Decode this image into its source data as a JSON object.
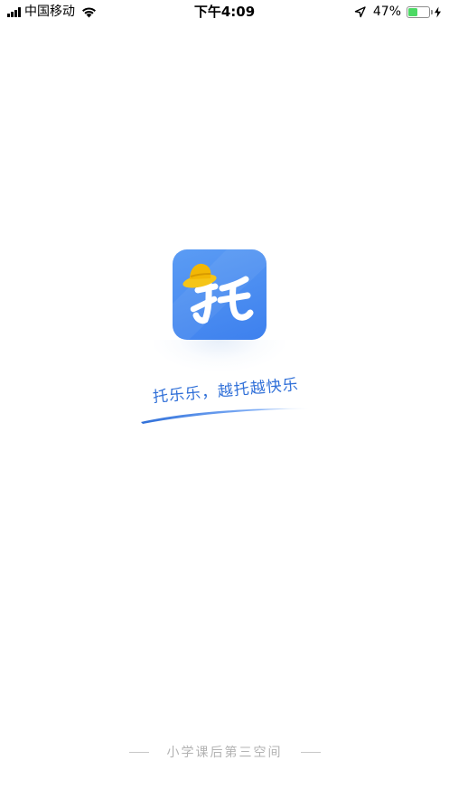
{
  "status_bar": {
    "carrier": "中国移动",
    "time": "下午4:09",
    "battery_percent": "47%",
    "battery_level": 0.47,
    "icons": [
      "signal-icon",
      "wifi-icon",
      "location-arrow-icon",
      "battery-icon",
      "charging-bolt-icon"
    ]
  },
  "splash": {
    "logo_icon": "app-logo-tuo-character-with-yellow-hat",
    "slogan": "托乐乐，越托越快乐",
    "footer_text": "小学课后第三空间"
  },
  "colors": {
    "brand_blue": "#4a8cf2",
    "slogan_blue": "#2f6fd8",
    "hat_yellow": "#f5c518",
    "footer_gray": "#b3b3b3",
    "battery_green": "#4cd964"
  }
}
